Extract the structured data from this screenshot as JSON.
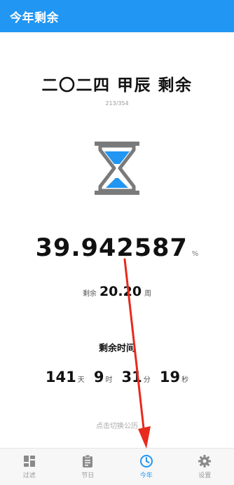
{
  "app": {
    "title": "今年剩余"
  },
  "main": {
    "year_title": "二〇二四 甲辰 剩余",
    "day_progress": "213/354",
    "percent_value": "39.942587",
    "percent_unit": "%",
    "weeks_prefix": "剩余",
    "weeks_value": "20.20",
    "weeks_unit": "周",
    "remaining_label": "剩余时间",
    "days_value": "141",
    "days_unit": "天",
    "hours_value": "9",
    "hours_unit": "时",
    "minutes_value": "31",
    "minutes_unit": "分",
    "seconds_value": "19",
    "seconds_unit": "秒",
    "switch_hint": "点击切换公历"
  },
  "nav": {
    "items": [
      {
        "label": "过滤",
        "icon": "dashboard-icon"
      },
      {
        "label": "节日",
        "icon": "clipboard-icon"
      },
      {
        "label": "今年",
        "icon": "clock-icon",
        "active": true
      },
      {
        "label": "设置",
        "icon": "gear-icon"
      }
    ]
  },
  "colors": {
    "accent": "#2196F3",
    "hourglass_frame": "#7a7a7a",
    "hourglass_sand": "#2196F3",
    "arrow": "#e8291c"
  }
}
